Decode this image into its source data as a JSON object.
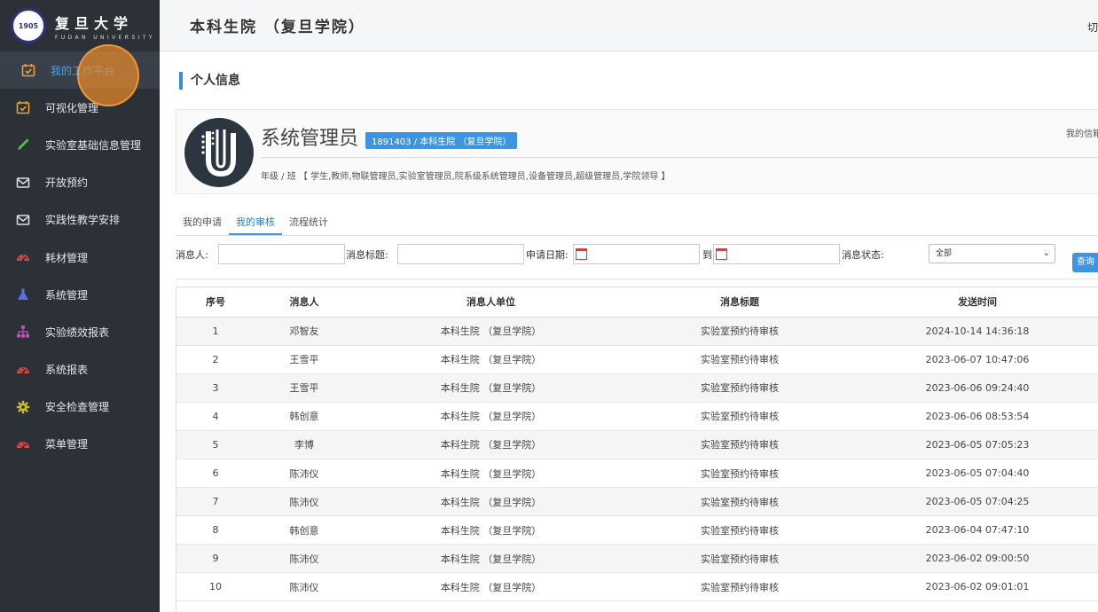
{
  "logo": {
    "seal_text": "1905",
    "cn": "复旦大学",
    "en": "FUDAN UNIVERSITY"
  },
  "sidebar": {
    "items": [
      {
        "label": "我的工作平台",
        "icon": "calendar-check-icon",
        "color": "#e8a33d",
        "active": true
      },
      {
        "label": "可视化管理",
        "icon": "calendar-check-icon",
        "color": "#e8a33d"
      },
      {
        "label": "实验室基础信息管理",
        "icon": "eyedropper-icon",
        "color": "#4cc24c"
      },
      {
        "label": "开放预约",
        "icon": "envelope-icon",
        "color": "#e0e0e0"
      },
      {
        "label": "实践性教学安排",
        "icon": "envelope-icon",
        "color": "#e0e0e0"
      },
      {
        "label": "耗材管理",
        "icon": "dashboard-icon",
        "color": "#e04848"
      },
      {
        "label": "系统管理",
        "icon": "flask-icon",
        "color": "#5a6fe0"
      },
      {
        "label": "实验绩效报表",
        "icon": "sitemap-icon",
        "color": "#c34fc3"
      },
      {
        "label": "系统报表",
        "icon": "dashboard-icon",
        "color": "#e04848"
      },
      {
        "label": "安全检查管理",
        "icon": "gear-icon",
        "color": "#c9b82c"
      },
      {
        "label": "菜单管理",
        "icon": "dashboard-icon",
        "color": "#e04848"
      }
    ]
  },
  "header": {
    "title": "本科生院 （复旦学院）",
    "cut_text": "切"
  },
  "section": {
    "title": "个人信息"
  },
  "profile": {
    "name": "系统管理员",
    "badge": "1891403 / 本科生院 （复旦学院）",
    "roles": "年级 / 班 【 学生,教师,物联管理员,实验室管理员,院系级系统管理员,设备管理员,超级管理员,学院领导 】",
    "msg": "我的信箱"
  },
  "tabs": [
    {
      "label": "我的申请",
      "active": false
    },
    {
      "label": "我的审核",
      "active": true
    },
    {
      "label": "流程统计",
      "active": false
    }
  ],
  "filter": {
    "sender_label": "消息人:",
    "title_label": "消息标题:",
    "date_label": "申请日期:",
    "to_label": "到",
    "status_label": "消息状态:",
    "status_value": "全部",
    "query_button": "查询"
  },
  "table": {
    "columns": [
      "序号",
      "消息人",
      "消息人单位",
      "消息标题",
      "发送时间"
    ],
    "rows": [
      [
        "1",
        "邓智友",
        "本科生院 （复旦学院）",
        "实验室预约待审核",
        "2024-10-14 14:36:18"
      ],
      [
        "2",
        "王雪平",
        "本科生院 （复旦学院）",
        "实验室预约待审核",
        "2023-06-07 10:47:06"
      ],
      [
        "3",
        "王雪平",
        "本科生院 （复旦学院）",
        "实验室预约待审核",
        "2023-06-06 09:24:40"
      ],
      [
        "4",
        "韩创意",
        "本科生院 （复旦学院）",
        "实验室预约待审核",
        "2023-06-06 08:53:54"
      ],
      [
        "5",
        "李博",
        "本科生院 （复旦学院）",
        "实验室预约待审核",
        "2023-06-05 07:05:23"
      ],
      [
        "6",
        "陈沛仪",
        "本科生院 （复旦学院）",
        "实验室预约待审核",
        "2023-06-05 07:04:40"
      ],
      [
        "7",
        "陈沛仪",
        "本科生院 （复旦学院）",
        "实验室预约待审核",
        "2023-06-05 07:04:25"
      ],
      [
        "8",
        "韩创意",
        "本科生院 （复旦学院）",
        "实验室预约待审核",
        "2023-06-04 07:47:10"
      ],
      [
        "9",
        "陈沛仪",
        "本科生院 （复旦学院）",
        "实验室预约待审核",
        "2023-06-02 09:00:50"
      ],
      [
        "10",
        "陈沛仪",
        "本科生院 （复旦学院）",
        "实验室预约待审核",
        "2023-06-02 09:01:01"
      ]
    ]
  }
}
